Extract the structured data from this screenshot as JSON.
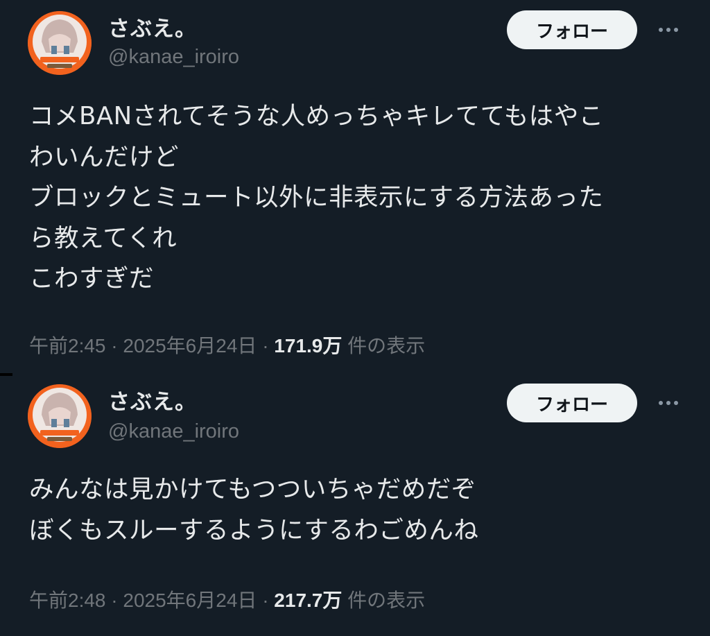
{
  "tweets": [
    {
      "display_name": "さぶえ。",
      "handle": "@kanae_iroiro",
      "follow_label": "フォロー",
      "more_icon": "more-horizontal-icon",
      "text": "コメBANされてそうな人めっちゃキレててもはやこ\nわいんだけど\nブロックとミュート以外に非表示にする方法あった\nら教えてくれ\nこわすぎだ",
      "time": "午前2:45",
      "date": "2025年6月24日",
      "sep": "·",
      "views": "171.9万",
      "views_suffix": "件の表示"
    },
    {
      "display_name": "さぶえ。",
      "handle": "@kanae_iroiro",
      "follow_label": "フォロー",
      "more_icon": "more-horizontal-icon",
      "text": "みんなは見かけてもつついちゃだめだぞ\nぼくもスルーするようにするわごめんね",
      "time": "午前2:48",
      "date": "2025年6月24日",
      "sep": "·",
      "views": "217.7万",
      "views_suffix": "件の表示"
    }
  ],
  "colors": {
    "background": "#141d26",
    "text_primary": "#e7e9ea",
    "text_secondary": "#71767b",
    "button_bg": "#eff3f4",
    "avatar_ring": "#f2621e"
  }
}
